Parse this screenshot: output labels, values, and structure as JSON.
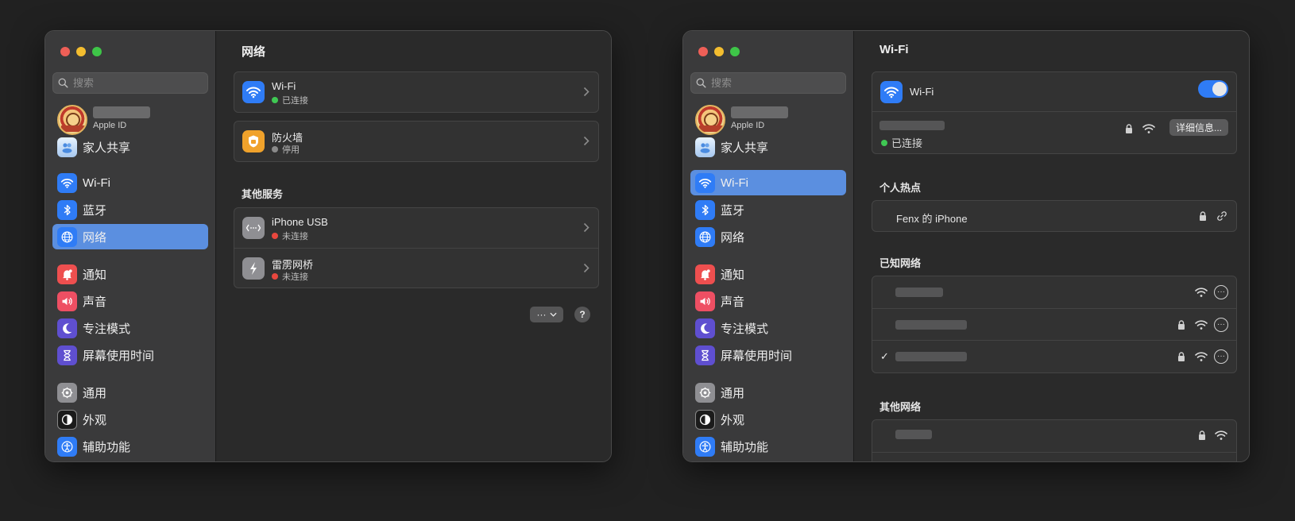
{
  "sidebar": {
    "search_placeholder": "搜索",
    "account_sub": "Apple ID",
    "items": {
      "family": "家人共享",
      "wifi": "Wi-Fi",
      "bluetooth": "蓝牙",
      "network": "网络",
      "notifications": "通知",
      "sound": "声音",
      "focus": "专注模式",
      "screentime": "屏幕使用时间",
      "general": "通用",
      "appearance": "外观",
      "accessibility": "辅助功能"
    }
  },
  "network_window": {
    "title": "网络",
    "services": [
      {
        "name": "Wi-Fi",
        "status": "已连接",
        "status_color": "#3fc853"
      },
      {
        "name": "防火墙",
        "status": "停用",
        "status_color": "#8a8a8a"
      }
    ],
    "other_services_title": "其他服务",
    "other_services": [
      {
        "name": "iPhone USB",
        "status": "未连接",
        "status_color": "#e8473e"
      },
      {
        "name": "雷雳网桥",
        "status": "未连接",
        "status_color": "#e8473e"
      }
    ],
    "more_button": "···",
    "help_button": "?"
  },
  "wifi_window": {
    "title": "Wi-Fi",
    "wifi_label": "Wi-Fi",
    "wifi_enabled": true,
    "connected_status": "已连接",
    "details_button": "详细信息...",
    "hotspot_title": "个人热点",
    "hotspot_name": "Fenx 的 iPhone",
    "known_title": "已知网络",
    "other_title": "其他网络",
    "check_mark": "✓"
  },
  "colors": {
    "accent": "#5b8fe0",
    "wifi_blue": "#2f7cf6",
    "status_green": "#3fc853",
    "status_red": "#e8473e"
  }
}
